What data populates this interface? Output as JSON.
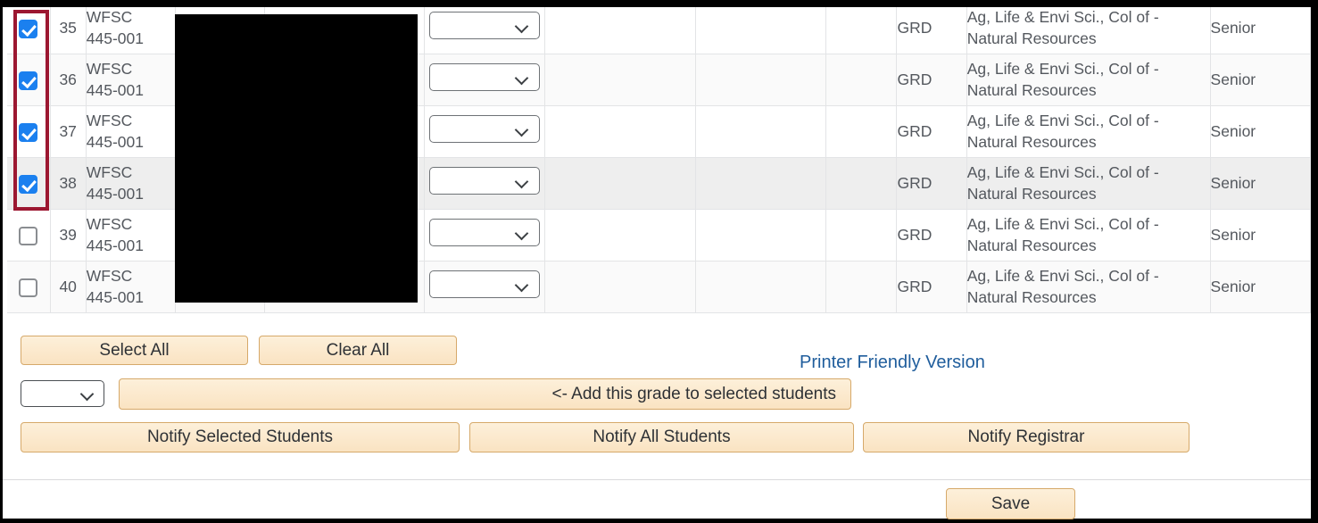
{
  "table": {
    "columns": [
      "select",
      "row_number",
      "course",
      "student_name",
      "student_id",
      "grade",
      "blank1",
      "blank2",
      "blank3",
      "grading_basis",
      "college_major",
      "class_level"
    ],
    "rows": [
      {
        "checked": true,
        "number": "35",
        "course_line1": "WFSC",
        "course_line2": "445-001",
        "grade": "",
        "grading_basis": "GRD",
        "college_line1": "Ag, Life & Envi Sci., Col of -",
        "college_line2": "Natural Resources",
        "class_level": "Senior",
        "redacted": true,
        "highlighted": false
      },
      {
        "checked": true,
        "number": "36",
        "course_line1": "WFSC",
        "course_line2": "445-001",
        "grade": "",
        "grading_basis": "GRD",
        "college_line1": "Ag, Life & Envi Sci., Col of -",
        "college_line2": "Natural Resources",
        "class_level": "Senior",
        "redacted": true,
        "highlighted": false
      },
      {
        "checked": true,
        "number": "37",
        "course_line1": "WFSC",
        "course_line2": "445-001",
        "grade": "",
        "grading_basis": "GRD",
        "college_line1": "Ag, Life & Envi Sci., Col of -",
        "college_line2": "Natural Resources",
        "class_level": "Senior",
        "redacted": true,
        "highlighted": false
      },
      {
        "checked": true,
        "number": "38",
        "course_line1": "WFSC",
        "course_line2": "445-001",
        "grade": "",
        "grading_basis": "GRD",
        "college_line1": "Ag, Life & Envi Sci., Col of -",
        "college_line2": "Natural Resources",
        "class_level": "Senior",
        "redacted": true,
        "highlighted": true
      },
      {
        "checked": false,
        "number": "39",
        "course_line1": "WFSC",
        "course_line2": "445-001",
        "grade": "",
        "grading_basis": "GRD",
        "college_line1": "Ag, Life & Envi Sci., Col of -",
        "college_line2": "Natural Resources",
        "class_level": "Senior",
        "redacted": true,
        "highlighted": false
      },
      {
        "checked": false,
        "number": "40",
        "course_line1": "WFSC",
        "course_line2": "445-001",
        "grade": "",
        "grading_basis": "GRD",
        "college_line1": "Ag, Life & Envi Sci., Col of -",
        "college_line2": "Natural Resources",
        "class_level": "Senior",
        "redacted": true,
        "highlighted": false
      }
    ]
  },
  "actions": {
    "select_all": "Select All",
    "clear_all": "Clear All",
    "grade_dropdown_value": "",
    "add_grade": "<- Add this grade to selected students",
    "notify_selected": "Notify Selected Students",
    "notify_all": "Notify All Students",
    "notify_registrar": "Notify Registrar",
    "printer_friendly": "Printer Friendly Version",
    "save": "Save"
  },
  "annotation": {
    "highlight_color": "#9c1731",
    "highlight_target": "checkbox-column-rows-35-38"
  },
  "colors": {
    "checkbox_checked": "#1b80ef",
    "button_fill": "#fae3c2",
    "button_border": "#d6a96a",
    "link": "#1f5d9c",
    "row_highlight": "#eeeeee",
    "redaction": "#000000"
  }
}
